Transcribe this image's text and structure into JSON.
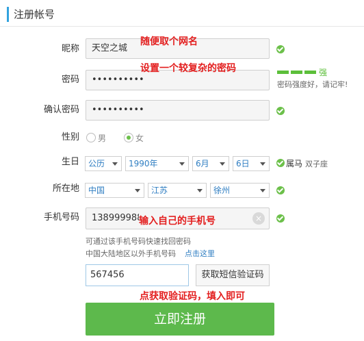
{
  "page": {
    "title": "注册帐号"
  },
  "form": {
    "nickname": {
      "label": "昵称",
      "value": "天空之城",
      "annotation": "随便取个网名"
    },
    "password": {
      "label": "密码",
      "value": "••••••••••",
      "annotation": "设置一个较复杂的密码",
      "strength_label": "强",
      "strength_hint": "密码强度好，请记牢!"
    },
    "confirm_password": {
      "label": "确认密码",
      "value": "••••••••••"
    },
    "gender": {
      "label": "性别",
      "options": [
        "男",
        "女"
      ],
      "selected": "女"
    },
    "birthday": {
      "label": "生日",
      "calendar": "公历",
      "year": "1990年",
      "month": "6月",
      "day": "6日",
      "zodiac": "属马",
      "constellation": "双子座"
    },
    "location": {
      "label": "所在地",
      "country": "中国",
      "province": "江苏",
      "city": "徐州"
    },
    "phone": {
      "label": "手机号码",
      "value": "138999988",
      "annotation": "输入自己的手机号",
      "hint1": "可通过该手机号码快速找回密码",
      "hint2": "中国大陆地区以外手机号码",
      "hint_link": "点击这里"
    },
    "verify": {
      "value": "567456",
      "button_label": "获取短信验证码",
      "annotation": "点获取验证码，填入即可"
    },
    "submit_label": "立即注册"
  },
  "colors": {
    "accent": "#31a2de",
    "success": "#6cc04a",
    "annotation": "#e31f1f",
    "submit": "#5db94c",
    "link": "#2f7ec2"
  }
}
